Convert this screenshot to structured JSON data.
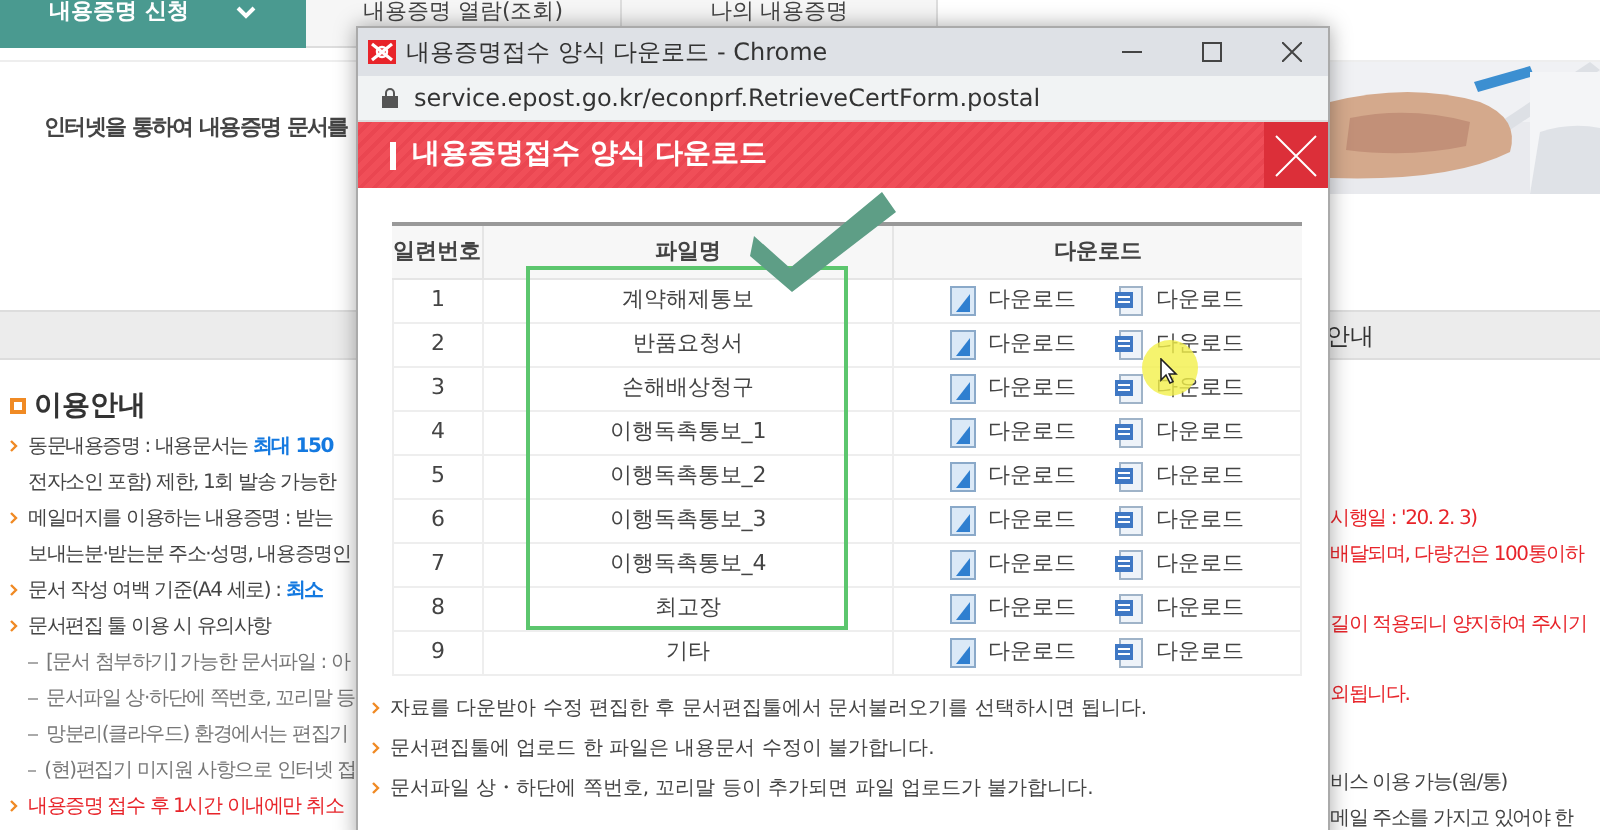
{
  "page": {
    "tabs": [
      {
        "label": "내용증명 신청",
        "selected": true
      },
      {
        "label": "내용증명 열람(조회)",
        "selected": false
      },
      {
        "label": "나의 내용증명",
        "selected": false
      }
    ],
    "intro": "인터넷을 통하여 내용증명 문서를",
    "section_tab": "안내",
    "guide": {
      "title": "이용안내",
      "items": [
        {
          "kind": "bullet",
          "text": "동문내용증명 : 내용문서는 ",
          "emphasis": "최대 150"
        },
        {
          "kind": "cont",
          "text": "전자소인 포함) 제한, 1회 발송 가능한"
        },
        {
          "kind": "bullet",
          "text": "메일머지를 이용하는 내용증명 : 받는"
        },
        {
          "kind": "cont",
          "text": "보내는분·받는분 주소·성명, 내용증명인"
        },
        {
          "kind": "bullet",
          "text": "문서 작성 여백 기준(A4 세로) : ",
          "emphasis": "최소"
        },
        {
          "kind": "bullet",
          "text": "문서편집 툴 이용 시 유의사항"
        },
        {
          "kind": "sub",
          "text": "[문서 첨부하기] 가능한 문서파일 : 아"
        },
        {
          "kind": "sub",
          "text": "문서파일 상·하단에 쪽번호, 꼬리말 등"
        },
        {
          "kind": "sub",
          "text": "망분리(클라우드) 환경에서는 편집기"
        },
        {
          "kind": "sub",
          "text": "(현)편집기 미지원 사항으로 인터넷 접"
        },
        {
          "kind": "warning",
          "text": "내용증명 접수 후 1시간 이내에만 취소"
        }
      ]
    },
    "right_fragments": [
      {
        "kind": "warning",
        "text": "시행일 : '20. 2. 3)"
      },
      {
        "kind": "warning",
        "text": "배달되며, 다량건은 100통이하"
      },
      {
        "kind": "warning",
        "text": "길이 적용되니 양지하여 주시기"
      },
      {
        "kind": "warning",
        "text": "외됩니다."
      },
      {
        "kind": "normal",
        "text": "비스 이용 가능(원/통)"
      },
      {
        "kind": "normal",
        "text": "메일 주소를 가지고 있어야 한"
      }
    ]
  },
  "popup": {
    "window_title": "내용증명접수 양식 다운로드 - Chrome",
    "url": "service.epost.go.kr/econprf.RetrieveCertForm.postal",
    "header": "내용증명접수 양식 다운로드",
    "columns": [
      "일련번호",
      "파일명",
      "다운로드"
    ],
    "rows": [
      {
        "number": "1",
        "file": "계약해제통보",
        "downloads": [
          "다운로드",
          "다운로드"
        ]
      },
      {
        "number": "2",
        "file": "반품요청서",
        "downloads": [
          "다운로드",
          "다운로드"
        ]
      },
      {
        "number": "3",
        "file": "손해배상청구",
        "downloads": [
          "다운로드",
          "다운로드"
        ]
      },
      {
        "number": "4",
        "file": "이행독촉통보_1",
        "downloads": [
          "다운로드",
          "다운로드"
        ]
      },
      {
        "number": "5",
        "file": "이행독촉통보_2",
        "downloads": [
          "다운로드",
          "다운로드"
        ]
      },
      {
        "number": "6",
        "file": "이행독촉통보_3",
        "downloads": [
          "다운로드",
          "다운로드"
        ]
      },
      {
        "number": "7",
        "file": "이행독촉통보_4",
        "downloads": [
          "다운로드",
          "다운로드"
        ]
      },
      {
        "number": "8",
        "file": "최고장",
        "downloads": [
          "다운로드",
          "다운로드"
        ]
      },
      {
        "number": "9",
        "file": "기타",
        "downloads": [
          "다운로드",
          "다운로드"
        ]
      }
    ],
    "notes": [
      "자료를 다운받아 수정 편집한 후 문서편집툴에서 문서불러오기를 선택하시면 됩니다.",
      "문서편집툴에 업로드 한 파일은 내용문서 수정이 불가합니다.",
      "문서파일 상・하단에 쪽번호, 꼬리말 등이 추가되면 파일 업로드가 불가합니다."
    ]
  }
}
